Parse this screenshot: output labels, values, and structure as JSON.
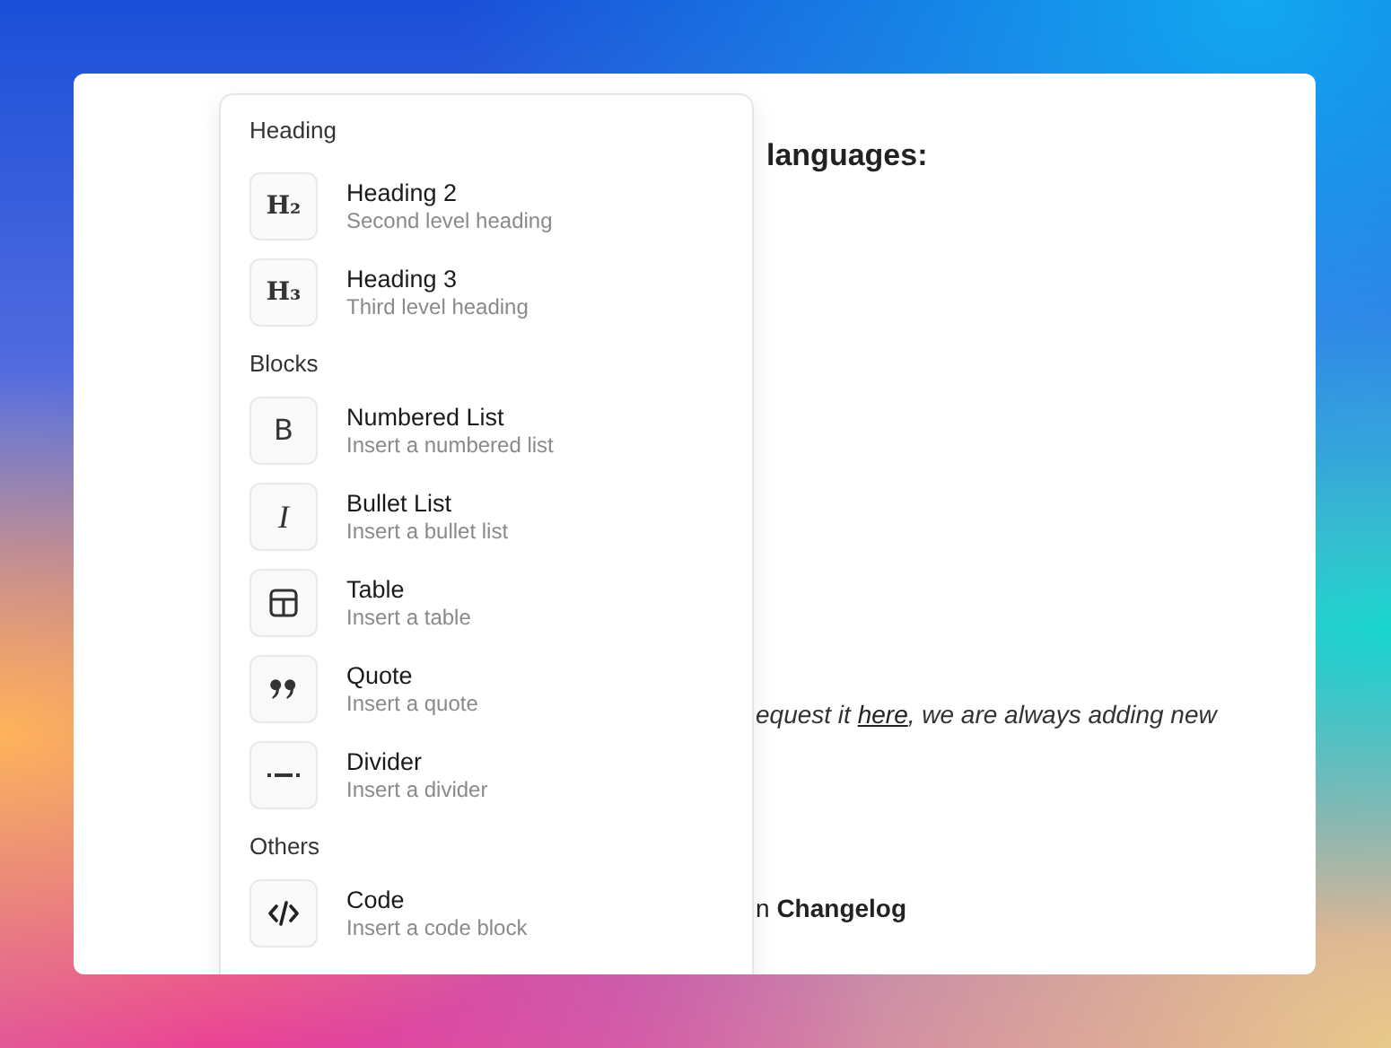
{
  "document": {
    "heading_fragment": "languages:",
    "paragraph_fragment": {
      "before": "equest it ",
      "link": "here",
      "after": ", we are always adding new"
    },
    "changelog_fragment": {
      "before": "n ",
      "bold": "Changelog"
    }
  },
  "menu": {
    "sections": [
      {
        "title": "Heading",
        "items": [
          {
            "title": "Heading 2",
            "subtitle": "Second level heading",
            "icon": {
              "kind": "serif-glyph",
              "glyph": "H₂"
            }
          },
          {
            "title": "Heading 3",
            "subtitle": "Third level heading",
            "icon": {
              "kind": "serif-glyph",
              "glyph": "H₃"
            }
          }
        ]
      },
      {
        "title": "Blocks",
        "items": [
          {
            "title": "Numbered List",
            "subtitle": "Insert a numbered list",
            "icon": {
              "kind": "glyph",
              "glyph": "B"
            }
          },
          {
            "title": "Bullet List",
            "subtitle": "Insert a bullet list",
            "icon": {
              "kind": "italic-glyph",
              "glyph": "I"
            }
          },
          {
            "title": "Table",
            "subtitle": "Insert a table",
            "icon": {
              "kind": "table"
            }
          },
          {
            "title": "Quote",
            "subtitle": "Insert a quote",
            "icon": {
              "kind": "quote"
            }
          },
          {
            "title": "Divider",
            "subtitle": "Insert a divider",
            "icon": {
              "kind": "divider"
            }
          }
        ]
      },
      {
        "title": "Others",
        "items": [
          {
            "title": "Code",
            "subtitle": "Insert a code block",
            "icon": {
              "kind": "code"
            }
          }
        ]
      }
    ]
  }
}
